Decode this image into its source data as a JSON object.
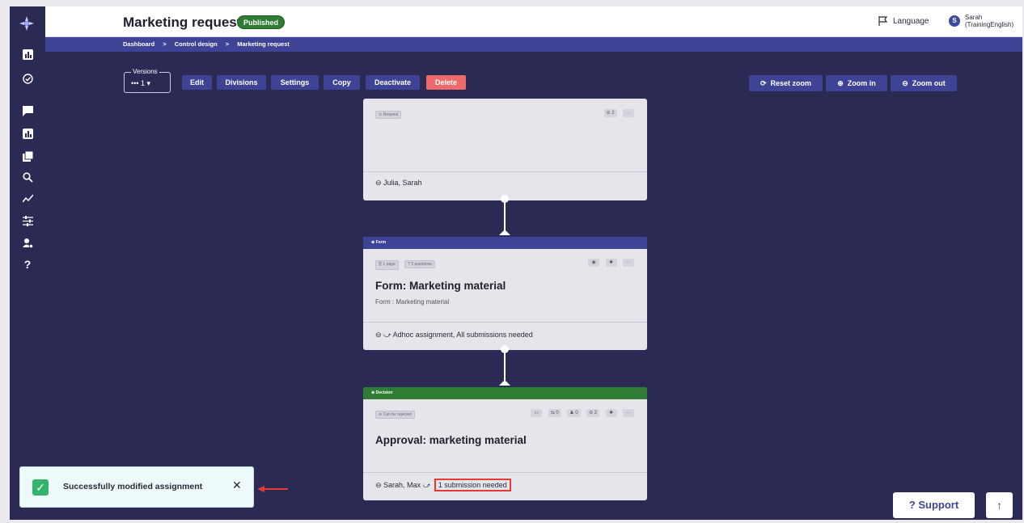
{
  "header": {
    "title": "Marketing request",
    "status_badge": "Published",
    "language_label": "Language",
    "user_initial": "S",
    "user_name": "Sarah",
    "user_detail": "(TrainingEnglish)"
  },
  "breadcrumb": [
    "Dashboard",
    ">",
    "Control design",
    ">",
    "Marketing request"
  ],
  "toolbar": {
    "versions_label": "Versions",
    "versions_value": "••• 1 ▾",
    "edit": "Edit",
    "divisions": "Divisions",
    "settings": "Settings",
    "copy": "Copy",
    "deactivate": "Deactivate",
    "delete": "Delete",
    "reset_zoom": "Reset zoom",
    "zoom_in": "Zoom in",
    "zoom_out": "Zoom out"
  },
  "cards": {
    "request": {
      "tag": "⊙ Request",
      "count": "⊖ 2",
      "more": "···",
      "footer": "⊖ Julia, Sarah"
    },
    "form": {
      "header": "⊕ Form",
      "tag_pages": "🗎 1 page",
      "tag_questions": "? 5 questions",
      "title": "Form: Marketing material",
      "subtitle": "Form : Marketing material",
      "footer": "⊖ ⤻ Adhoc assignment, All submissions needed"
    },
    "decision": {
      "header": "⊕ Decision",
      "tag": "⊝ Can be rejected",
      "count_a": "⇆ 0",
      "count_b": "♟ 0",
      "count_c": "⊖ 2",
      "title": "Approval: marketing material",
      "footer_people": "⊖ Sarah, Max  ⤻",
      "footer_submission": "1 submission needed"
    }
  },
  "toast": {
    "message": "Successfully modified assignment"
  },
  "support_label": "? Support",
  "colors": {
    "background": "#2b2a55",
    "primary": "#3e4396",
    "danger": "#ef6a6a",
    "success": "#2e7d32",
    "highlight": "#e53935"
  }
}
